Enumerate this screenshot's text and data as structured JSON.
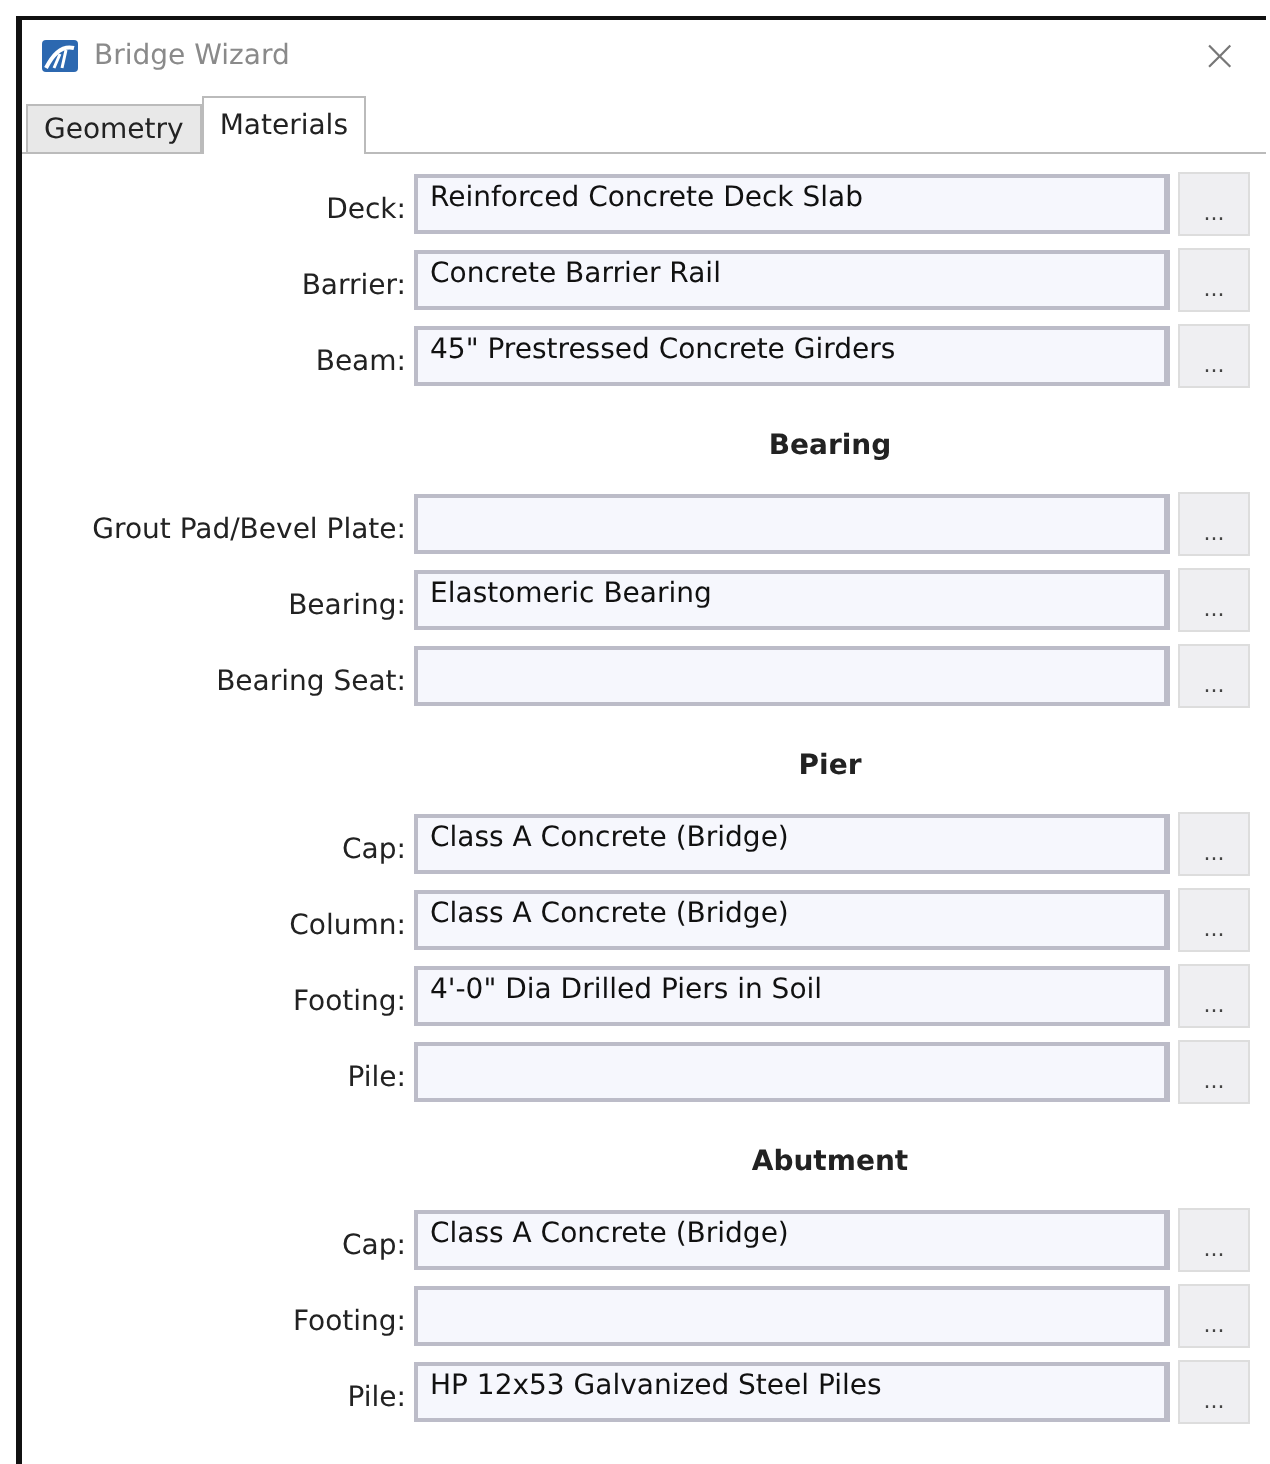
{
  "window": {
    "title": "Bridge Wizard",
    "close": "×"
  },
  "tabs": [
    {
      "label": "Geometry",
      "selected": false
    },
    {
      "label": "Materials",
      "selected": true
    }
  ],
  "sections": [
    {
      "fields": [
        {
          "label": "Deck:",
          "value": "Reinforced Concrete Deck Slab",
          "button": "..."
        },
        {
          "label": "Barrier:",
          "value": "Concrete Barrier Rail",
          "button": "..."
        },
        {
          "label": "Beam:",
          "value": "45\" Prestressed Concrete Girders",
          "button": "..."
        }
      ]
    },
    {
      "title": "Bearing",
      "fields": [
        {
          "label": "Grout Pad/Bevel Plate:",
          "button": "..."
        },
        {
          "label": "Bearing:",
          "value": "Elastomeric Bearing",
          "button": "..."
        },
        {
          "label": "Bearing Seat:",
          "button": "..."
        }
      ]
    },
    {
      "title": "Pier",
      "fields": [
        {
          "label": "Cap:",
          "value": "Class A Concrete (Bridge)",
          "button": "..."
        },
        {
          "label": "Column:",
          "value": "Class A Concrete (Bridge)",
          "button": "..."
        },
        {
          "label": "Footing:",
          "value": "4'-0\" Dia Drilled Piers in Soil",
          "button": "..."
        },
        {
          "label": "Pile:",
          "button": "..."
        }
      ]
    },
    {
      "title": "Abutment",
      "fields": [
        {
          "label": "Cap:",
          "value": "Class A Concrete (Bridge)",
          "button": "..."
        },
        {
          "label": "Footing:",
          "button": "..."
        },
        {
          "label": "Pile:",
          "value": "HP 12x53 Galvanized Steel Piles",
          "button": "..."
        }
      ]
    }
  ]
}
